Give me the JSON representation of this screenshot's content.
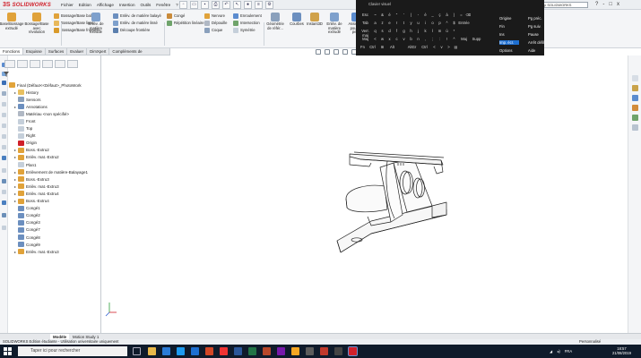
{
  "app": {
    "brand_mark": "3S",
    "brand_word": "SOLIDWORKS",
    "menus": [
      "Fichier",
      "Edition",
      "Affichage",
      "Insertion",
      "Outils",
      "Fenêtre",
      "?"
    ],
    "search_placeholder": "p SOLIDWORKS",
    "window_controls": [
      "?",
      "-",
      "□",
      "x"
    ]
  },
  "ribbon": {
    "big_buttons": [
      {
        "label": "Base/Bossage extrudé",
        "icon": "boss-extrude-icon"
      },
      {
        "label": "Bossage/Base avec révolution",
        "icon": "revolve-icon"
      }
    ],
    "small_col1": [
      "Bossage/Base balayé",
      "Bossage/Base lissé",
      "Bossage/Base frontière"
    ],
    "mid_big": [
      {
        "label": "Enlèv. de matière extrudé",
        "icon": "cut-extrude-icon"
      },
      {
        "label": "Assistance pour le perçage",
        "icon": "hole-wizard-icon"
      }
    ],
    "small_col2": [
      "Enlèv. de matière balayé",
      "Enlèv. de matière lissé",
      "Découpe frontière"
    ],
    "small_col3": [
      "Congé",
      "Répétition linéaire"
    ],
    "small_col4": [
      "Nervure",
      "Dépouille",
      "Coque"
    ],
    "small_col5": [
      "Enroulement",
      "Intersection",
      "Symétrie"
    ],
    "right_big": [
      {
        "label": "Géométrie de référ...",
        "icon": "reference-geometry-icon"
      },
      {
        "label": "Courbes",
        "icon": "curves-icon"
      },
      {
        "label": "Instant3D",
        "icon": "instant3d-icon"
      },
      {
        "label": "Enlèv. de matière extrudé",
        "icon": "cut-extrude-icon"
      },
      {
        "label": "Assista... pour le pe...",
        "icon": "hole-wizard-icon"
      }
    ]
  },
  "command_tabs": [
    "Fonctions",
    "Esquisse",
    "Surfaces",
    "Evaluer",
    "DimXpert",
    "Compléments de SOLIDWORKS"
  ],
  "tree": {
    "root": "Final (Défaut<<Défaut>_PhotoWork",
    "items": [
      {
        "label": "History",
        "icon": "folder-icon",
        "expand": "▸"
      },
      {
        "label": "Sensors",
        "icon": "sensor-icon",
        "expand": ""
      },
      {
        "label": "Annotations",
        "icon": "annotation-icon",
        "expand": "▸"
      },
      {
        "label": "Matériau <non spécifié>",
        "icon": "material-icon",
        "expand": ""
      },
      {
        "label": "Front",
        "icon": "plane-icon",
        "expand": ""
      },
      {
        "label": "Top",
        "icon": "plane-icon",
        "expand": ""
      },
      {
        "label": "Right",
        "icon": "plane-icon",
        "expand": ""
      },
      {
        "label": "Origin",
        "icon": "origin-icon",
        "expand": ""
      },
      {
        "label": "Boss.-Extru2",
        "icon": "feature-icon",
        "expand": "▸"
      },
      {
        "label": "Enlèv. mat.-Extru2",
        "icon": "feature-icon",
        "expand": "▸"
      },
      {
        "label": "Plan1",
        "icon": "plane-icon",
        "expand": ""
      },
      {
        "label": "Enlèvement de matière-Balayage1",
        "icon": "feature-icon",
        "expand": "▸"
      },
      {
        "label": "Boss.-Extru3",
        "icon": "feature-icon",
        "expand": "▸"
      },
      {
        "label": "Enlèv. mat.-Extru3",
        "icon": "feature-icon",
        "expand": "▸"
      },
      {
        "label": "Enlèv. mat.-Extru4",
        "icon": "feature-icon",
        "expand": "▸"
      },
      {
        "label": "Boss.-Extru4",
        "icon": "feature-icon",
        "expand": "▸"
      },
      {
        "label": "Congé1",
        "icon": "fillet-icon",
        "expand": ""
      },
      {
        "label": "Congé2",
        "icon": "fillet-icon",
        "expand": ""
      },
      {
        "label": "Congé3",
        "icon": "fillet-icon",
        "expand": ""
      },
      {
        "label": "Congé7",
        "icon": "fillet-icon",
        "expand": ""
      },
      {
        "label": "Congé8",
        "icon": "fillet-icon",
        "expand": ""
      },
      {
        "label": "Congé9",
        "icon": "fillet-icon",
        "expand": ""
      },
      {
        "label": "Enlèv. mat.-Extru3",
        "icon": "feature-icon",
        "expand": "▸"
      }
    ]
  },
  "osk": {
    "title": "Clavier visuel",
    "rows": [
      [
        "Esc",
        "~",
        "&",
        "é",
        "\"",
        "'",
        "(",
        "-",
        "è",
        "_",
        "ç",
        "à",
        ")",
        "=",
        "⌫"
      ],
      [
        "Tab",
        "a",
        "z",
        "e",
        "r",
        "t",
        "y",
        "u",
        "i",
        "o",
        "p",
        "^",
        "$",
        "Entrée"
      ],
      [
        "Verr. maj",
        "q",
        "s",
        "d",
        "f",
        "g",
        "h",
        "j",
        "k",
        "l",
        "m",
        "ù",
        "*"
      ],
      [
        "Maj",
        "<",
        "w",
        "x",
        "c",
        "v",
        "b",
        "n",
        ",",
        ";",
        ":",
        "!",
        "^",
        "Maj",
        "Supp"
      ],
      [
        "Fn",
        "Ctrl",
        "⊞",
        "Alt",
        "",
        "AltGr",
        "Ctrl",
        "<",
        "v",
        ">",
        "▤"
      ]
    ],
    "side": [
      [
        "Origine",
        "Pg préc."
      ],
      [
        "Fin",
        "Pg suiv."
      ],
      [
        "Ins",
        "Pause"
      ],
      [
        "Imp. écr.",
        "Arrêt défil"
      ],
      [
        "Options",
        "Aide"
      ]
    ]
  },
  "bottom_tabs": [
    "Modèle",
    "Motion Study 1"
  ],
  "status": {
    "left": "SOLIDWORKS Edition étudiante - Utilisation universitaire uniquement",
    "right": "Personnalisé"
  },
  "taskbar": {
    "search_placeholder": "Taper ici pour rechercher",
    "lang": "FRA",
    "time": "18:57",
    "date": "21/08/2019"
  }
}
